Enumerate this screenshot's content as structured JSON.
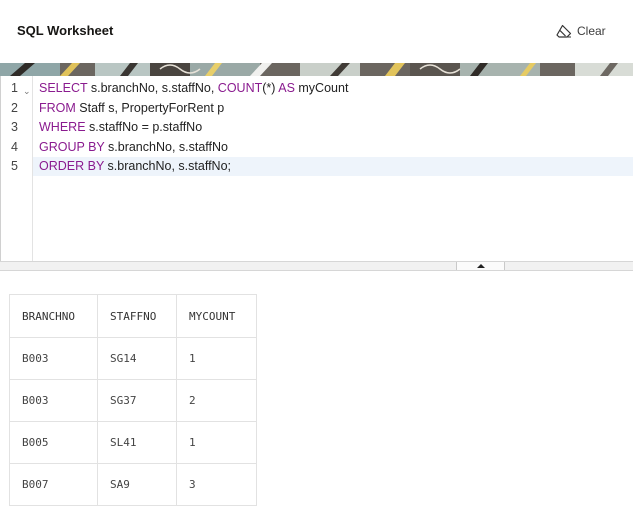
{
  "header": {
    "title": "SQL Worksheet",
    "clear_label": "Clear",
    "clear_icon": "eraser-icon"
  },
  "editor": {
    "line_numbers": [
      "1",
      "2",
      "3",
      "4",
      "5"
    ],
    "lines": [
      [
        {
          "t": "SELECT",
          "kw": true
        },
        {
          "t": " s.branchNo, s.staffNo, ",
          "kw": false
        },
        {
          "t": "COUNT",
          "kw": true
        },
        {
          "t": "(*) ",
          "kw": false
        },
        {
          "t": "AS",
          "kw": true
        },
        {
          "t": " myCount",
          "kw": false
        }
      ],
      [
        {
          "t": "FROM",
          "kw": true
        },
        {
          "t": " Staff s, PropertyForRent p",
          "kw": false
        }
      ],
      [
        {
          "t": "WHERE",
          "kw": true
        },
        {
          "t": " s.staffNo = p.staffNo",
          "kw": false
        }
      ],
      [
        {
          "t": "GROUP BY",
          "kw": true
        },
        {
          "t": " s.branchNo, s.staffNo",
          "kw": false
        }
      ],
      [
        {
          "t": "ORDER BY",
          "kw": true
        },
        {
          "t": " s.branchNo, s.staffNo;",
          "kw": false
        }
      ]
    ],
    "active_line": 5,
    "keyword_color": "#8a1b8f"
  },
  "results": {
    "columns": [
      "BRANCHNO",
      "STAFFNO",
      "MYCOUNT"
    ],
    "rows": [
      [
        "B003",
        "SG14",
        "1"
      ],
      [
        "B003",
        "SG37",
        "2"
      ],
      [
        "B005",
        "SL41",
        "1"
      ],
      [
        "B007",
        "SA9",
        "3"
      ]
    ]
  }
}
